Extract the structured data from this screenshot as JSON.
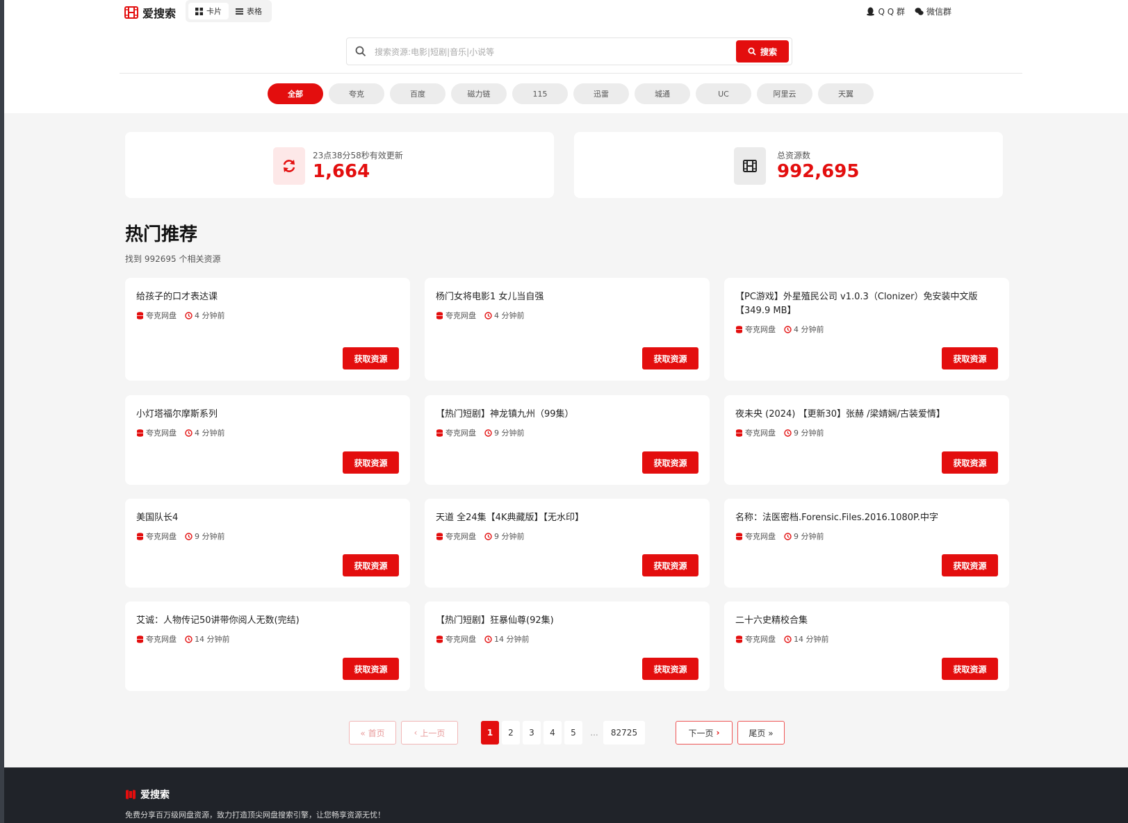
{
  "header": {
    "logo_text": "爱搜索",
    "view_card": "卡片",
    "view_table": "表格",
    "qq_group": "Q Q 群",
    "wechat_group": "微信群"
  },
  "search": {
    "placeholder": "搜索资源:电影|短剧|音乐|小说等",
    "button": "搜索"
  },
  "filters": [
    "全部",
    "夸克",
    "百度",
    "磁力链",
    "115",
    "迅雷",
    "城通",
    "UC",
    "阿里云",
    "天翼"
  ],
  "stats": {
    "updated_label": "23点38分58秒有效更新",
    "updated_value": "1,664",
    "total_label": "总资源数",
    "total_value": "992,695"
  },
  "section": {
    "title": "热门推荐",
    "subtitle": "找到 992695 个相关资源"
  },
  "cards": [
    {
      "title": "给孩子的口才表达课",
      "source": "夸克网盘",
      "time": "4 分钟前"
    },
    {
      "title": "杨门女将电影1 女儿当自强",
      "source": "夸克网盘",
      "time": "4 分钟前"
    },
    {
      "title": "【PC游戏】外星殖民公司 v1.0.3（Clonizer）免安装中文版【349.9 MB】",
      "source": "夸克网盘",
      "time": "4 分钟前"
    },
    {
      "title": "小灯塔福尔摩斯系列",
      "source": "夸克网盘",
      "time": "4 分钟前"
    },
    {
      "title": "【热门短剧】神龙镇九州（99集）",
      "source": "夸克网盘",
      "time": "9 分钟前"
    },
    {
      "title": "夜未央 (2024) 【更新30】张赫 /梁婧娴/古装爱情】",
      "source": "夸克网盘",
      "time": "9 分钟前"
    },
    {
      "title": "美国队长4",
      "source": "夸克网盘",
      "time": "9 分钟前"
    },
    {
      "title": "天道 全24集【4K典藏版】【无水印】",
      "source": "夸克网盘",
      "time": "9 分钟前"
    },
    {
      "title": "名称：法医密档.Forensic.Files.2016.1080P.中字",
      "source": "夸克网盘",
      "time": "9 分钟前"
    },
    {
      "title": "艾诚：人物传记50讲带你阅人无数(完结)",
      "source": "夸克网盘",
      "time": "14 分钟前"
    },
    {
      "title": "【热门短剧】狂暴仙尊(92集)",
      "source": "夸克网盘",
      "time": "14 分钟前"
    },
    {
      "title": "二十六史精校合集",
      "source": "夸克网盘",
      "time": "14 分钟前"
    }
  ],
  "get_button_label": "获取资源",
  "pagination": {
    "first": "« 首页",
    "prev": "上一页",
    "pages": [
      "1",
      "2",
      "3",
      "4",
      "5"
    ],
    "ellipsis": "...",
    "last_page": "82725",
    "next": "下一页",
    "end": "尾页 »"
  },
  "footer": {
    "logo_text": "爱搜索",
    "description": "免费分享百万级网盘资源，致力打造顶尖网盘搜索引擎，让您畅享资源无忧！"
  },
  "colors": {
    "accent": "#e30e0e",
    "footer_bg": "#202329",
    "page_bg": "#f5f5f5"
  }
}
